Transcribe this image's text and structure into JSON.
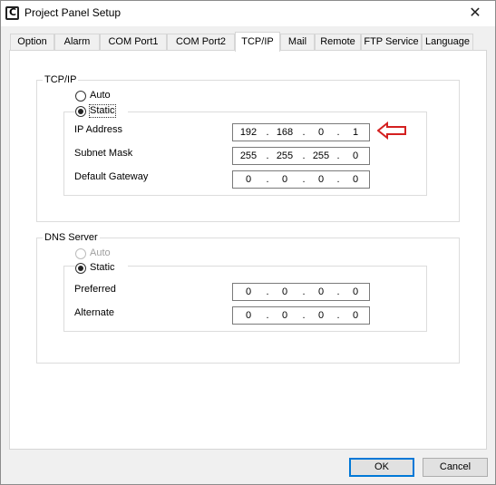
{
  "window": {
    "title": "Project Panel Setup",
    "close_glyph": "✕"
  },
  "tabs": [
    {
      "label": "Option"
    },
    {
      "label": "Alarm"
    },
    {
      "label": "COM Port1"
    },
    {
      "label": "COM Port2"
    },
    {
      "label": "TCP/IP",
      "active": true
    },
    {
      "label": "Mail"
    },
    {
      "label": "Remote"
    },
    {
      "label": "FTP Service"
    },
    {
      "label": "Language"
    }
  ],
  "tcpip": {
    "title": "TCP/IP",
    "auto_label": "Auto",
    "static_label": "Static",
    "selected": "Static",
    "ip_address": {
      "label": "IP Address",
      "octets": [
        "192",
        "168",
        "0",
        "1"
      ]
    },
    "subnet_mask": {
      "label": "Subnet Mask",
      "octets": [
        "255",
        "255",
        "255",
        "0"
      ]
    },
    "default_gateway": {
      "label": "Default Gateway",
      "octets": [
        "0",
        "0",
        "0",
        "0"
      ]
    }
  },
  "dns": {
    "title": "DNS Server",
    "auto_label": "Auto",
    "auto_disabled": true,
    "static_label": "Static",
    "selected": "Static",
    "preferred": {
      "label": "Preferred",
      "octets": [
        "0",
        "0",
        "0",
        "0"
      ]
    },
    "alternate": {
      "label": "Alternate",
      "octets": [
        "0",
        "0",
        "0",
        "0"
      ]
    }
  },
  "annotation": {
    "arrow_color": "#d42020",
    "icon": "left-arrow-icon"
  },
  "buttons": {
    "ok": "OK",
    "cancel": "Cancel"
  },
  "colors": {
    "default_button_border": "#0078d7"
  }
}
